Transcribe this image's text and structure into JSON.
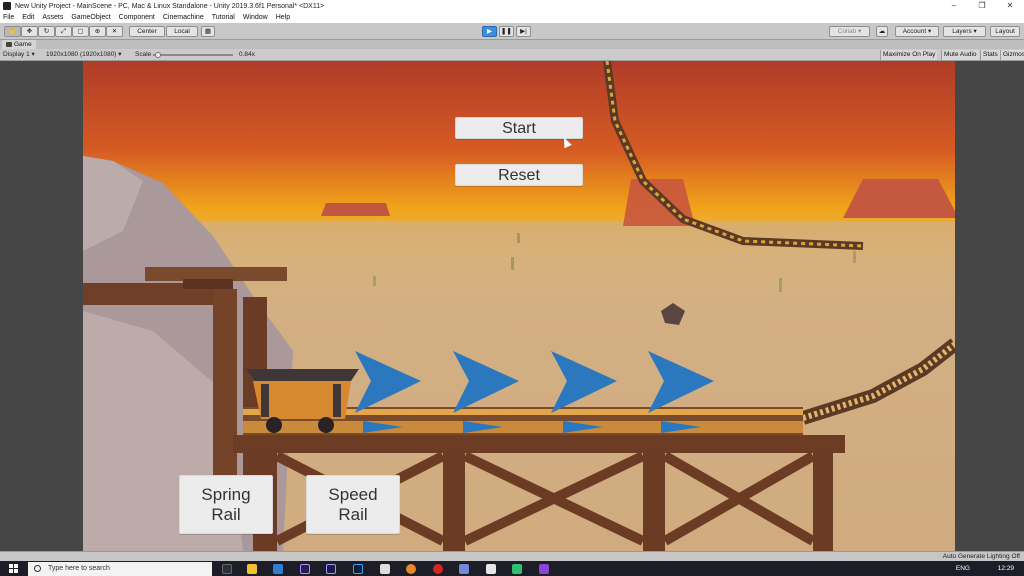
{
  "window": {
    "title": "New Unity Project - MainScene - PC, Mac & Linux Standalone - Unity 2019.3.6f1 Personal* <DX11>",
    "controls": [
      "–",
      "❐",
      "✕"
    ]
  },
  "menu": [
    "File",
    "Edit",
    "Assets",
    "GameObject",
    "Component",
    "Cinemachine",
    "Tutorial",
    "Window",
    "Help"
  ],
  "toolbar": {
    "pivot_label": "Center",
    "space_label": "Local",
    "collab_label": "Collab ▾",
    "account_label": "Account ▾",
    "layers_label": "Layers ▾",
    "layout_label": "Layout"
  },
  "game_tab": {
    "label": "Game"
  },
  "game_toolbar": {
    "display": "Display 1 ▾",
    "resolution": "1920x1080 (1920x1080) ▾",
    "scale_label": "Scale",
    "scale_value": "0.84x",
    "maximize": "Maximize On Play",
    "mute": "Mute Audio",
    "stats": "Stats",
    "gizmos": "Gizmos"
  },
  "game_ui": {
    "start": "Start",
    "reset": "Reset",
    "spring_line1": "Spring",
    "spring_line2": "Rail",
    "speed_line1": "Speed",
    "speed_line2": "Rail"
  },
  "status": {
    "text": "Auto Generate Lighting Off"
  },
  "taskbar": {
    "search_placeholder": "Type here to search",
    "lang": "ENG",
    "time": "12:29"
  },
  "colors": {
    "sky_top": "#b2432a",
    "sky_mid": "#f0a818",
    "desert": "#d0a878",
    "wood": "#6e4028",
    "arrow": "#2b78be"
  }
}
